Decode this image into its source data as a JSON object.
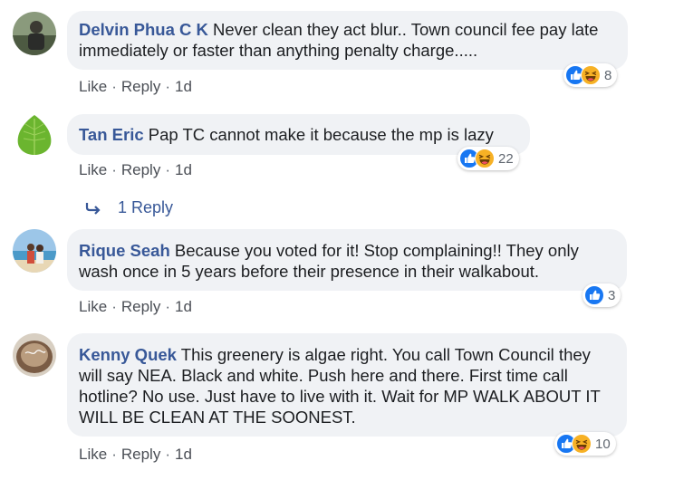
{
  "colors": {
    "author": "#385898",
    "bubble": "#f0f2f5",
    "like_blue": "#1877f2",
    "haha_yellow": "#f7b125"
  },
  "comments": [
    {
      "author": "Delvin Phua C K",
      "text": "Never clean they act blur.. Town council fee pay late immediately or faster than anything penalty charge.....",
      "actions": {
        "like": "Like",
        "reply": "Reply",
        "time": "1d"
      },
      "reactions": {
        "icons": [
          "like-icon",
          "haha-icon"
        ],
        "count": "8"
      }
    },
    {
      "author": "Tan Eric",
      "text": "Pap TC cannot make it because the mp is lazy",
      "actions": {
        "like": "Like",
        "reply": "Reply",
        "time": "1d"
      },
      "reactions": {
        "icons": [
          "like-icon",
          "haha-icon"
        ],
        "count": "22"
      },
      "replies_link": "1 Reply"
    },
    {
      "author": "Rique Seah",
      "text": "Because you voted for it! Stop complaining!! They only wash once in 5 years before their presence in their walkabout.",
      "actions": {
        "like": "Like",
        "reply": "Reply",
        "time": "1d"
      },
      "reactions": {
        "icons": [
          "like-icon"
        ],
        "count": "3"
      }
    },
    {
      "author": "Kenny Quek",
      "text": "This greenery is algae right. You call Town Council they will say NEA. Black and white. Push here and there. First time call hotline? No use. Just have to live with it. Wait for MP WALK ABOUT IT WILL BE CLEAN AT THE SOONEST.",
      "actions": {
        "like": "Like",
        "reply": "Reply",
        "time": "1d"
      },
      "reactions": {
        "icons": [
          "like-icon",
          "haha-icon"
        ],
        "count": "10"
      }
    }
  ]
}
